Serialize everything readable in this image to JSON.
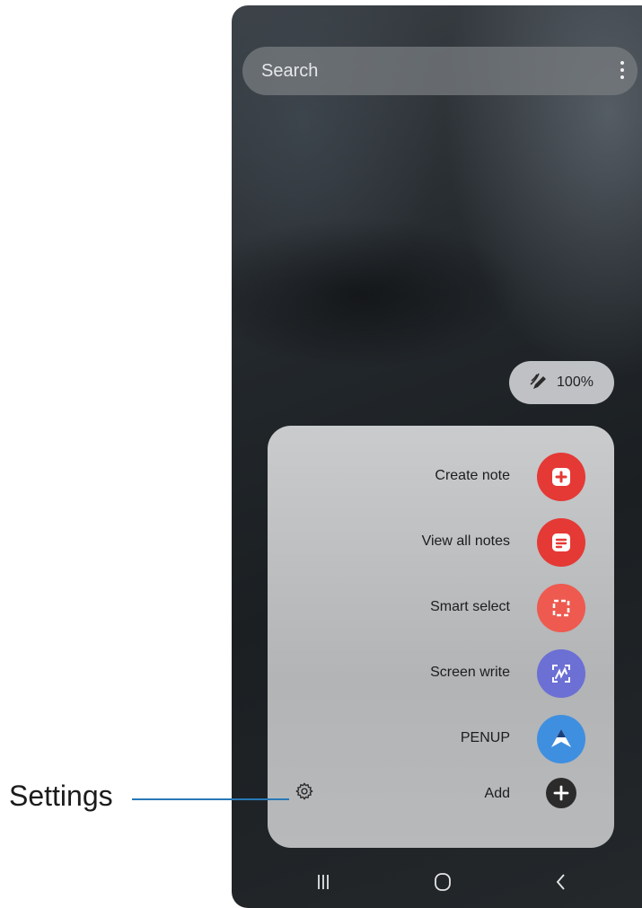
{
  "search": {
    "placeholder": "Search"
  },
  "zoom": {
    "value": "100%"
  },
  "menu_items": [
    {
      "label": "Create note",
      "icon": "create-note-icon",
      "color": "#e53935"
    },
    {
      "label": "View all notes",
      "icon": "view-all-notes-icon",
      "color": "#e53935"
    },
    {
      "label": "Smart select",
      "icon": "smart-select-icon",
      "color": "#ee5a4f"
    },
    {
      "label": "Screen write",
      "icon": "screen-write-icon",
      "color": "#6c6fd4"
    },
    {
      "label": "PENUP",
      "icon": "penup-icon",
      "color": "#3f8fe0"
    }
  ],
  "add": {
    "label": "Add",
    "icon": "add-icon"
  },
  "settings": {
    "icon": "gear-icon"
  },
  "callout": {
    "label": "Settings",
    "line_color": "#2878b8"
  },
  "navbar": {
    "items": [
      "recent-apps-icon",
      "home-icon",
      "back-icon"
    ]
  }
}
